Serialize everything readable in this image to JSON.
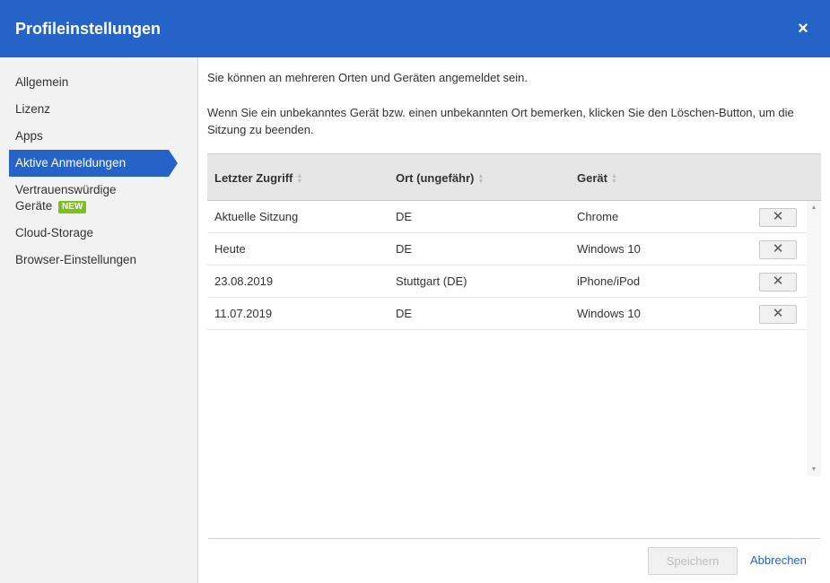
{
  "header": {
    "title": "Profileinstellungen",
    "close_icon": "×"
  },
  "sidebar": {
    "items": [
      {
        "label": "Allgemein"
      },
      {
        "label": "Lizenz"
      },
      {
        "label": "Apps"
      },
      {
        "label": "Aktive Anmeldungen",
        "active": true
      },
      {
        "label_line1": "Vertrauenswürdige",
        "label_line2": "Geräte",
        "badge": "NEW"
      },
      {
        "label": "Cloud-Storage"
      },
      {
        "label": "Browser-Einstellungen"
      }
    ]
  },
  "main": {
    "intro": "Sie können an mehreren Orten und Geräten angemeldet sein.",
    "intro2": "Wenn Sie ein unbekanntes Gerät bzw. einen unbekannten Ort bemerken, klicken Sie den Löschen-Button, um die Sitzung zu beenden.",
    "table": {
      "columns": [
        "Letzter Zugriff",
        "Ort (ungefähr)",
        "Gerät"
      ],
      "rows": [
        {
          "last": "Aktuelle Sitzung",
          "place": "DE",
          "device": "Chrome"
        },
        {
          "last": "Heute",
          "place": "DE",
          "device": "Windows 10"
        },
        {
          "last": "23.08.2019",
          "place": "Stuttgart (DE)",
          "device": "iPhone/iPod"
        },
        {
          "last": "11.07.2019",
          "place": "DE",
          "device": "Windows 10"
        }
      ],
      "delete_icon": "✕"
    },
    "footer": {
      "save_label": "Speichern",
      "cancel_label": "Abbrechen"
    }
  },
  "colors": {
    "accent": "#2563c9",
    "badge_green": "#7ac11a"
  }
}
